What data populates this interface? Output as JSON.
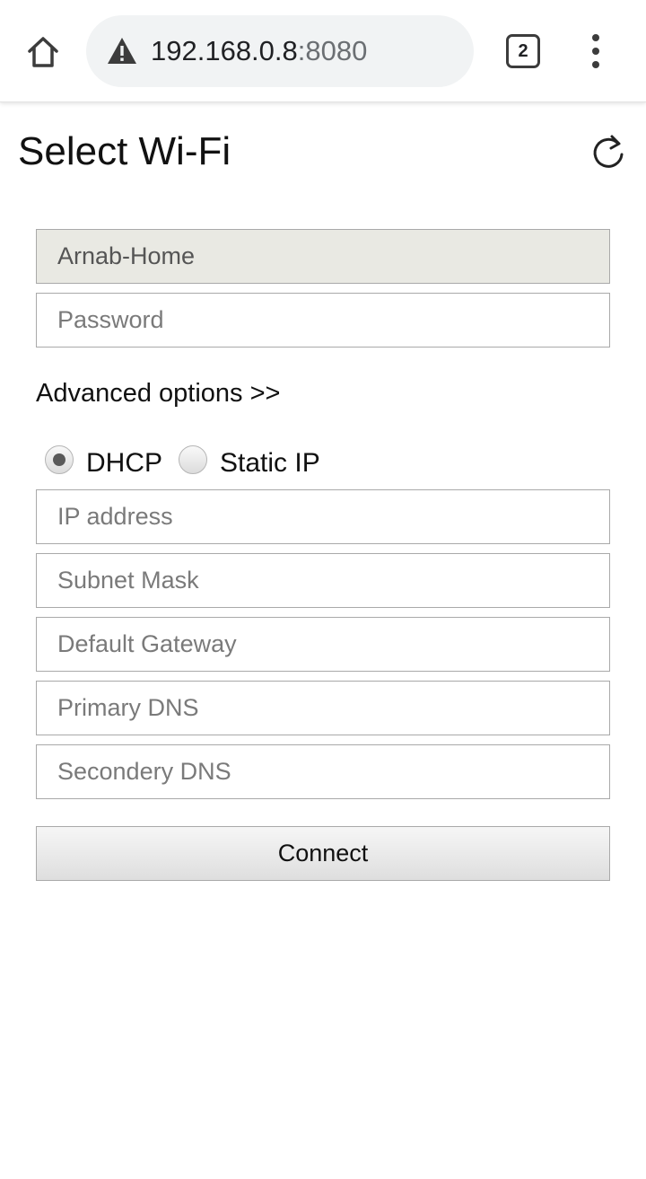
{
  "browser": {
    "url_host": "192.168.0.8",
    "url_port": ":8080",
    "tab_count": "2",
    "icons": {
      "home": "home-icon",
      "security_warning": "warning-icon",
      "menu": "more-vert-icon"
    }
  },
  "page": {
    "title": "Select Wi-Fi",
    "refresh_icon": "refresh-icon"
  },
  "form": {
    "ssid_value": "Arnab-Home",
    "password_placeholder": "Password",
    "advanced_label": "Advanced options >>",
    "ip_mode": {
      "options": [
        {
          "label": "DHCP",
          "checked": true
        },
        {
          "label": "Static IP",
          "checked": false
        }
      ]
    },
    "ip_address_placeholder": "IP address",
    "subnet_mask_placeholder": "Subnet Mask",
    "default_gateway_placeholder": "Default Gateway",
    "primary_dns_placeholder": "Primary DNS",
    "secondary_dns_placeholder": "Secondery DNS",
    "connect_label": "Connect"
  },
  "colors": {
    "readonly_field_bg": "#e9e9e3",
    "field_border": "#a9a9a9",
    "urlbar_bg": "#f1f3f4"
  }
}
